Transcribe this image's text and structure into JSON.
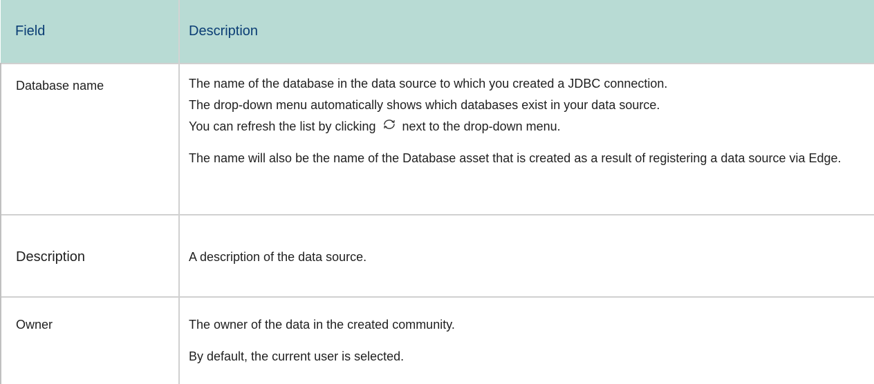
{
  "table": {
    "headers": {
      "field": "Field",
      "description": "Description"
    },
    "rows": [
      {
        "field": "Database name",
        "paragraphs": [
          {
            "line1": "The name of the database in the data source to which you created a JDBC connection.",
            "line2": "The drop-down menu automatically shows which databases exist in your data source.",
            "line3_before": "You can refresh the list by clicking",
            "line3_icon": "refresh-icon",
            "line3_after": "next to the drop-down menu."
          },
          {
            "text": "The name will also be the name of the Database asset that is created as a result of registering a data source via Edge."
          }
        ]
      },
      {
        "field": "Description",
        "paragraphs": [
          {
            "text": "A description of the data source."
          }
        ]
      },
      {
        "field": "Owner",
        "paragraphs": [
          {
            "text": "The owner of the data in the created community."
          },
          {
            "text": "By default, the current user is selected."
          }
        ]
      }
    ]
  },
  "colors": {
    "header_bg": "#b8dbd4",
    "header_text": "#0a3d74",
    "body_text": "#1f1f1f",
    "border": "#d0d0d0"
  }
}
